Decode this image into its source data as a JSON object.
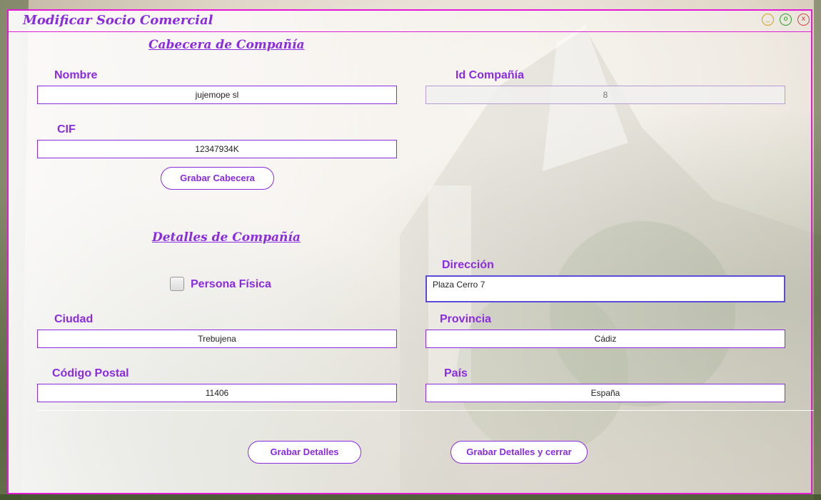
{
  "window": {
    "title": "Modificar Socio Comercial",
    "controls": {
      "minimize": "_",
      "maximize": "o",
      "close": "x"
    }
  },
  "header_section": {
    "title": "Cabecera de Compañía",
    "nombre_label": "Nombre",
    "nombre_value": "jujemope sl",
    "id_label": "Id Compañía",
    "id_value": "8",
    "cif_label": "CIF",
    "cif_value": "12347934K",
    "save_button": "Grabar Cabecera"
  },
  "details_section": {
    "title": "Detalles de Compañía",
    "persona_fisica_label": "Persona Física",
    "persona_fisica_checked": false,
    "direccion_label": "Dirección",
    "direccion_value": "Plaza Cerro 7",
    "ciudad_label": "Ciudad",
    "ciudad_value": "Trebujena",
    "provincia_label": "Provincia",
    "provincia_value": "Cádiz",
    "cp_label": "Código Postal",
    "cp_value": "11406",
    "pais_label": "País",
    "pais_value": "España"
  },
  "footer": {
    "save_details_button": "Grabar Detalles",
    "save_close_button": "Grabar Detalles y cerrar"
  },
  "colors": {
    "accent": "#8a2be2",
    "border": "#e21ad6"
  }
}
